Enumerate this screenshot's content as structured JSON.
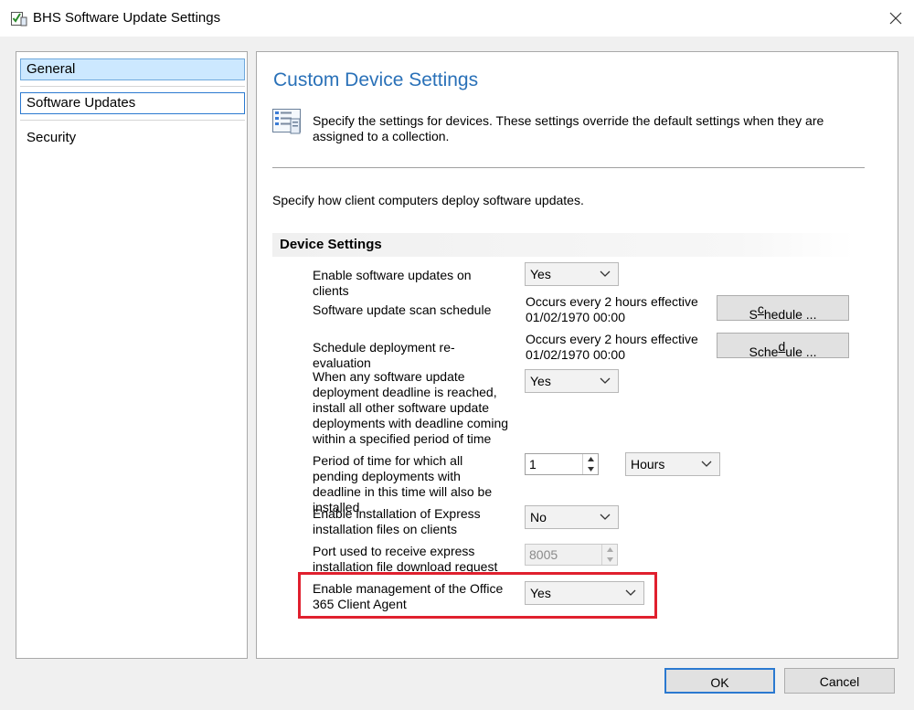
{
  "window": {
    "title": "BHS Software Update Settings",
    "icons": {
      "app": "settings-checklist-icon",
      "close": "close-icon"
    }
  },
  "nav": {
    "items": [
      {
        "label": "General",
        "state": "selected"
      },
      {
        "label": "Software Updates",
        "state": "focused"
      },
      {
        "label": "Security",
        "state": "normal"
      }
    ]
  },
  "panel": {
    "title": "Custom Device Settings",
    "description": "Specify the settings for devices. These settings override the default settings when they are assigned to a collection.",
    "intro": "Specify how client computers deploy software updates.",
    "group_header": "Device Settings",
    "settings": {
      "enable_updates": {
        "label": "Enable software updates on clients",
        "value": "Yes"
      },
      "scan_schedule": {
        "label": "Software update scan schedule",
        "schedule_line1": "Occurs every 2 hours effective",
        "schedule_line2": "01/02/1970 00:00",
        "button_prefix": "S",
        "button_underlined": "c",
        "button_suffix": "hedule ..."
      },
      "reevaluation": {
        "label": "Schedule deployment re-evaluation",
        "schedule_line1": "Occurs every 2 hours effective",
        "schedule_line2": "01/02/1970 00:00",
        "button_prefix": "Sche",
        "button_underlined": "d",
        "button_suffix": "ule ..."
      },
      "deadline_install": {
        "label": "When any software update deployment deadline is reached, install all other software update deployments with deadline coming within a specified period of time",
        "value": "Yes"
      },
      "period": {
        "label": "Period of time for which all pending deployments with deadline in this time will also be installed",
        "amount": "1",
        "unit": "Hours"
      },
      "express": {
        "label": "Enable installation of Express installation files on clients",
        "value": "No"
      },
      "port": {
        "label": "Port used to receive express installation file download request",
        "value": "8005"
      },
      "office365": {
        "label": "Enable management of the Office 365 Client Agent",
        "value": "Yes"
      }
    }
  },
  "buttons": {
    "ok": "OK",
    "cancel": "Cancel"
  },
  "colors": {
    "accent_title": "#2a71b8",
    "highlight": "#e0202e",
    "selection": "#cce8ff"
  }
}
